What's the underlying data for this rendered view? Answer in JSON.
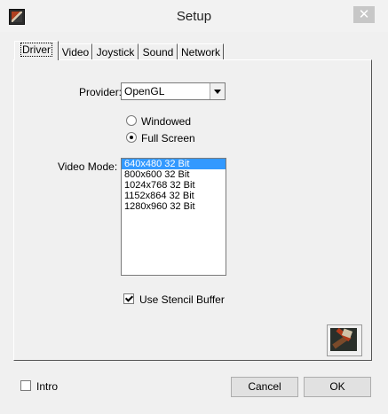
{
  "window": {
    "title": "Setup",
    "close_glyph": "✕"
  },
  "tabs": [
    {
      "label": "Driver",
      "active": true
    },
    {
      "label": "Video",
      "active": false
    },
    {
      "label": "Joystick",
      "active": false
    },
    {
      "label": "Sound",
      "active": false
    },
    {
      "label": "Network",
      "active": false
    }
  ],
  "driver": {
    "provider_label": "Provider:",
    "provider_value": "OpenGL",
    "mode_windowed": "Windowed",
    "mode_fullscreen": "Full Screen",
    "selected_mode": "Full Screen",
    "video_mode_label": "Video Mode:",
    "video_modes": [
      "640x480 32 Bit",
      "800x600 32 Bit",
      "1024x768 32 Bit",
      "1152x864 32 Bit",
      "1280x960 32 Bit"
    ],
    "selected_video_mode": "640x480 32 Bit",
    "stencil_label": "Use Stencil Buffer",
    "stencil_checked": true
  },
  "footer": {
    "intro_label": "Intro",
    "intro_checked": false,
    "cancel_label": "Cancel",
    "ok_label": "OK"
  },
  "icons": {
    "app": "app-logo-icon",
    "close": "close-icon",
    "logo_button": "game-logo-icon"
  }
}
